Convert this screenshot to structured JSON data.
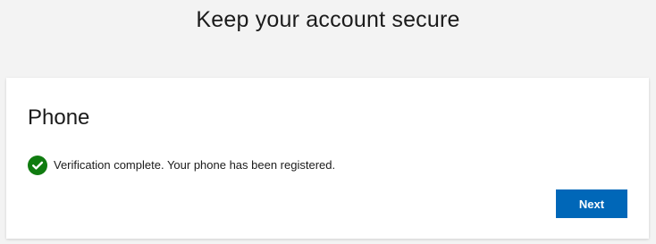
{
  "header": {
    "title": "Keep your account secure"
  },
  "card": {
    "title": "Phone",
    "status": {
      "text": "Verification complete. Your phone has been registered.",
      "icon": "check-circle-icon",
      "color": "#107c10"
    },
    "next_label": "Next"
  },
  "colors": {
    "accent": "#0067b8",
    "success": "#107c10",
    "page_background": "#f3f3f3",
    "card_background": "#ffffff"
  }
}
